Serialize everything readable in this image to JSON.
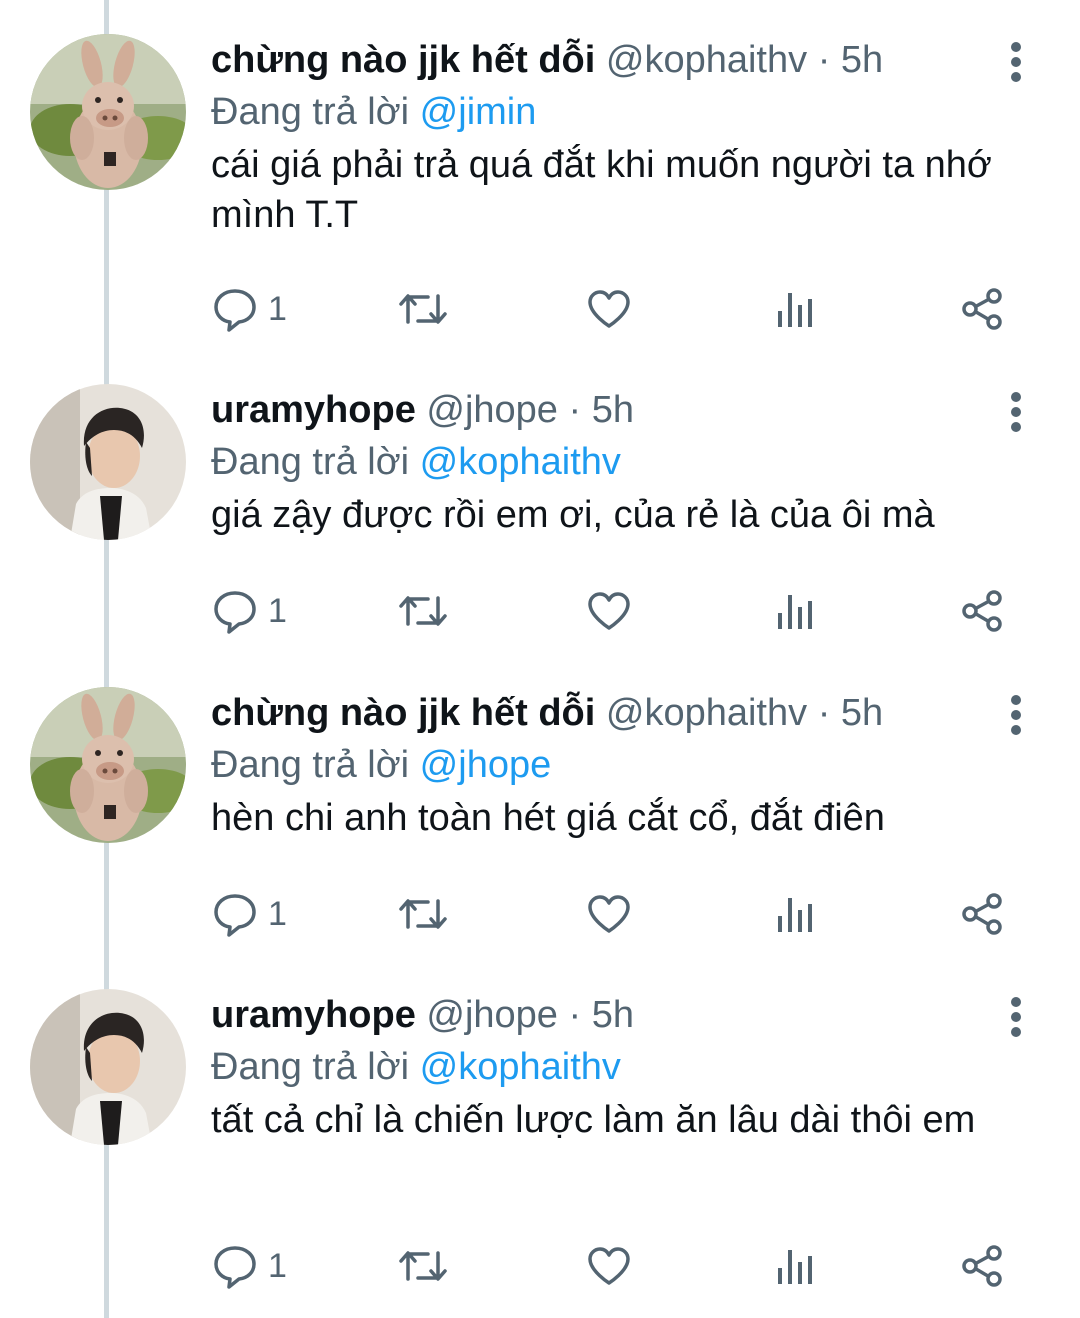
{
  "tweets": [
    {
      "avatar_icon": "pig-plush-avatar",
      "name": "chừng nào jjk hết dỗi",
      "handle": "@kophaithv",
      "time": "5h",
      "replying_prefix": "Đang trả lời",
      "replying_to": "@jimin",
      "text": "cái giá phải trả quá đắt khi muốn người ta nhớ mình T.T",
      "reply_count": "1"
    },
    {
      "avatar_icon": "person-portrait-avatar",
      "name": "uramyhope",
      "handle": "@jhope",
      "time": "5h",
      "replying_prefix": "Đang trả lời",
      "replying_to": "@kophaithv",
      "text": "giá zậy được rồi em ơi, của rẻ là của ôi mà",
      "reply_count": "1"
    },
    {
      "avatar_icon": "pig-plush-avatar",
      "name": "chừng nào jjk hết dỗi",
      "handle": "@kophaithv",
      "time": "5h",
      "replying_prefix": "Đang trả lời",
      "replying_to": "@jhope",
      "text": "hèn chi anh toàn hét giá cắt cổ, đắt điên",
      "reply_count": "1"
    },
    {
      "avatar_icon": "person-portrait-avatar",
      "name": "uramyhope",
      "handle": "@jhope",
      "time": "5h",
      "replying_prefix": "Đang trả lời",
      "replying_to": "@kophaithv",
      "text": "tất cả chỉ là chiến lược làm ăn lâu dài thôi em",
      "reply_count": "1"
    }
  ],
  "separator": "·",
  "icons": {
    "reply": "reply-bubble-icon",
    "retweet": "retweet-icon",
    "like": "heart-icon",
    "analytics": "analytics-bars-icon",
    "share": "share-icon",
    "more": "more-vertical-icon"
  },
  "colors": {
    "text": "#0f1419",
    "secondary": "#536471",
    "link": "#1d9bf0",
    "thread_line": "#cfd9de"
  }
}
